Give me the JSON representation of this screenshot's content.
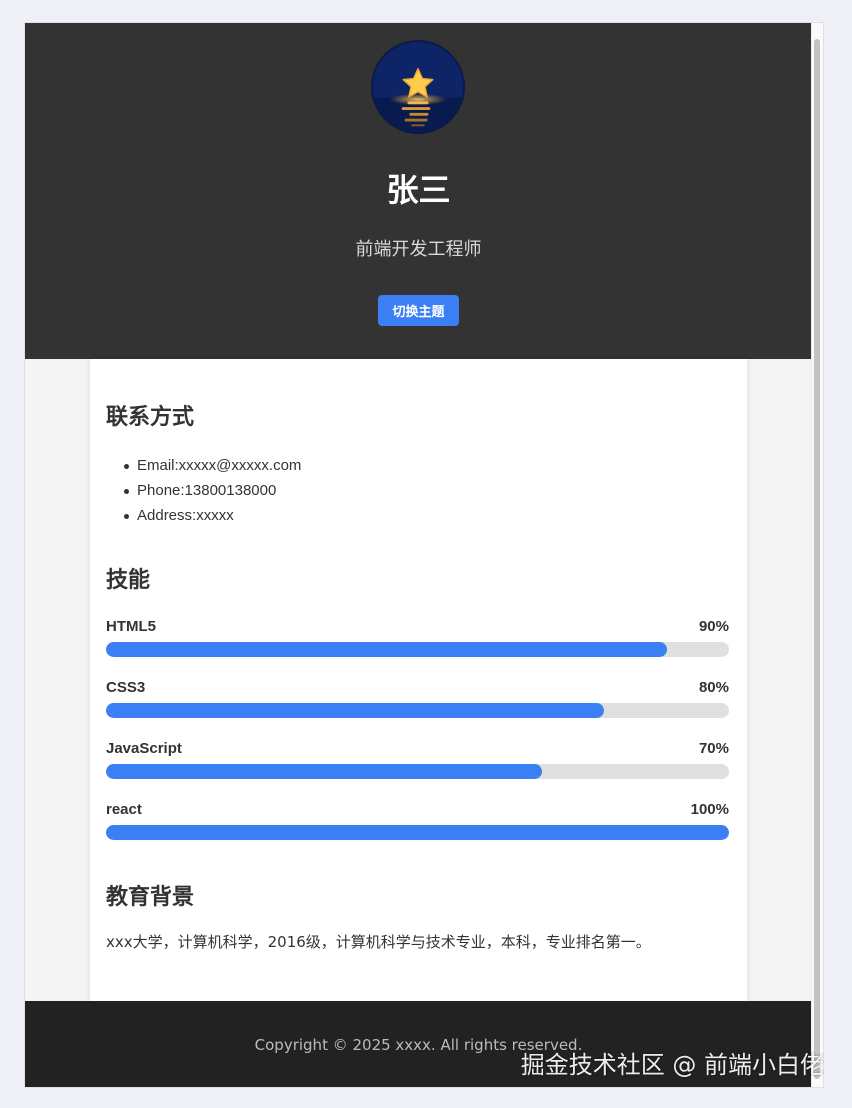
{
  "header": {
    "name": "张三",
    "title": "前端开发工程师",
    "theme_button": "切换主题"
  },
  "contact": {
    "heading": "联系方式",
    "items": [
      "Email:xxxxx@xxxxx.com",
      "Phone:13800138000",
      "Address:xxxxx"
    ]
  },
  "skills": {
    "heading": "技能",
    "items": [
      {
        "name": "HTML5",
        "percent_label": "90%",
        "level": 90
      },
      {
        "name": "CSS3",
        "percent_label": "80%",
        "level": 80
      },
      {
        "name": "JavaScript",
        "percent_label": "70%",
        "level": 70
      },
      {
        "name": "react",
        "percent_label": "100%",
        "level": 100
      }
    ]
  },
  "education": {
    "heading": "教育背景",
    "text": "xxx大学，计算机科学，2016级，计算机科学与技术专业，本科，专业排名第一。"
  },
  "footer": {
    "copyright": "Copyright © 2025 xxxx. All rights reserved."
  },
  "watermark": "掘金技术社区 @ 前端小白佬",
  "colors": {
    "header_bg": "#333333",
    "accent": "#3b7ff5",
    "footer_bg": "#222222",
    "bar_track": "#e0e0e0"
  },
  "icons": {
    "avatar": "star-over-water-avatar"
  }
}
